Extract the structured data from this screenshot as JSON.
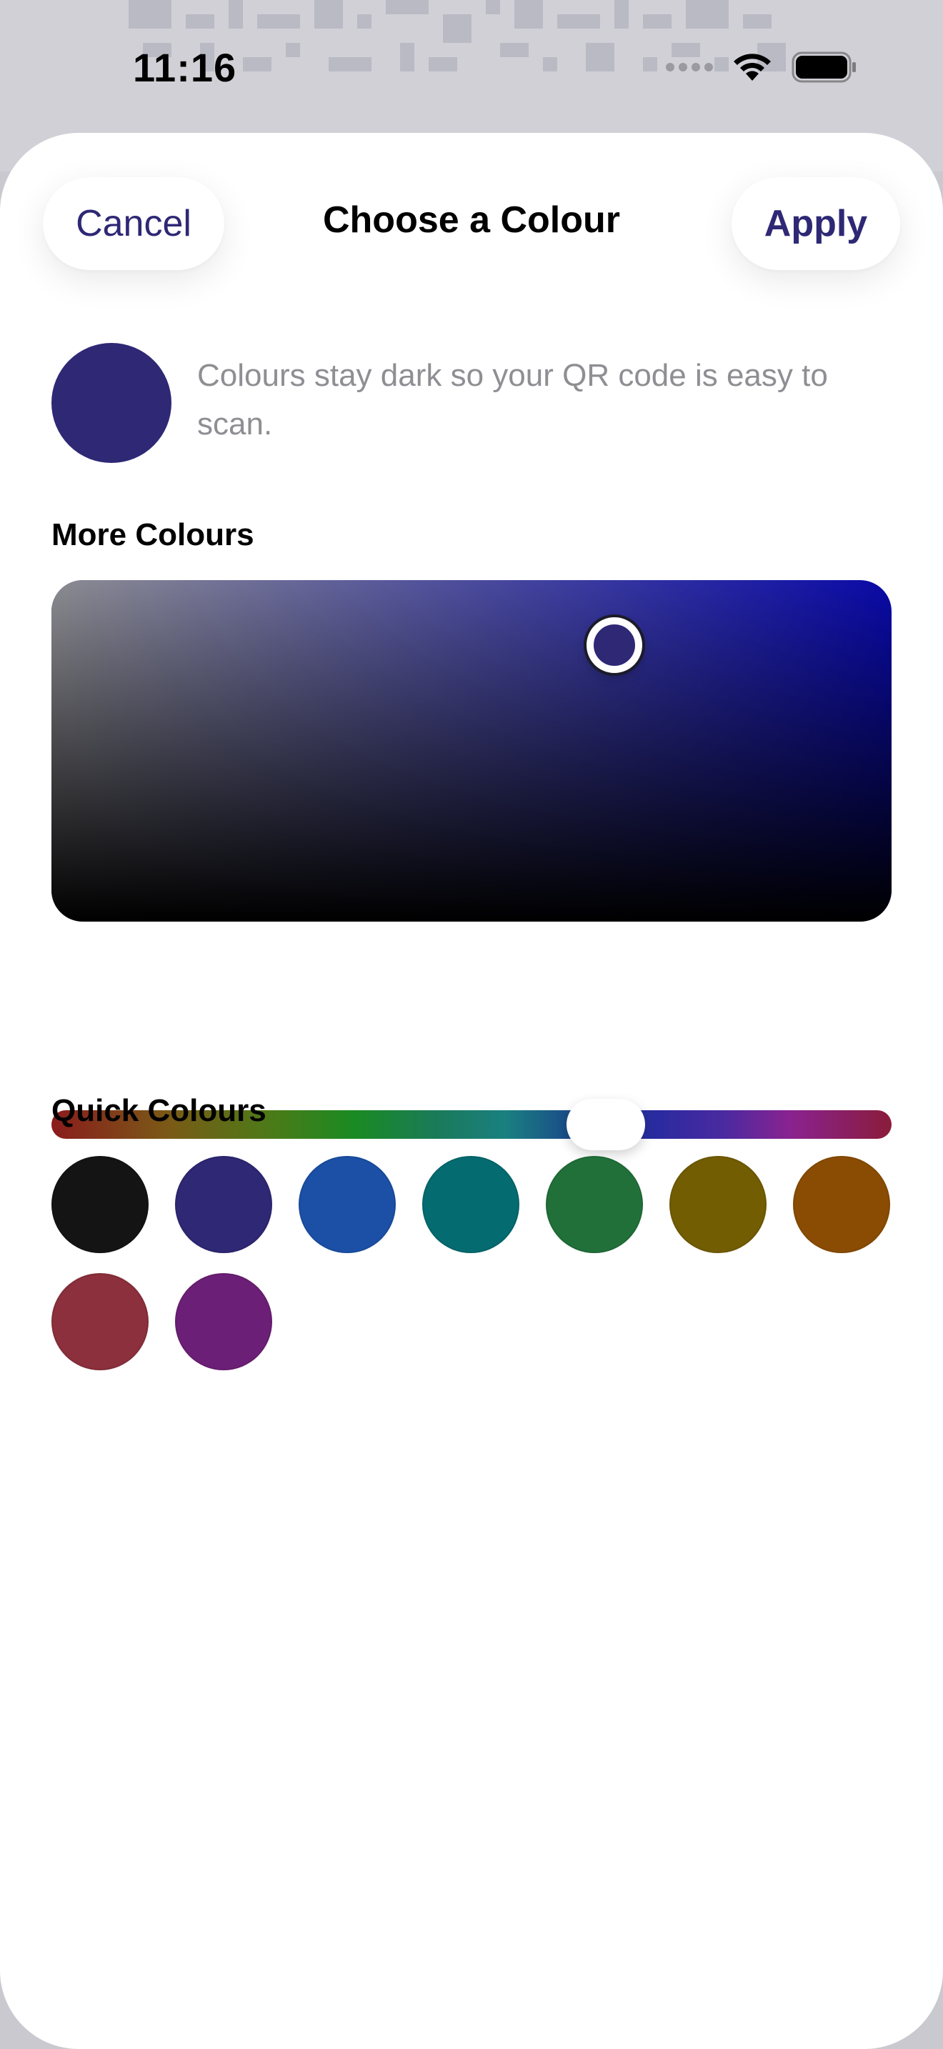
{
  "status_bar": {
    "time": "11:16"
  },
  "header": {
    "cancel_label": "Cancel",
    "title": "Choose a Colour",
    "apply_label": "Apply"
  },
  "preview": {
    "color": "#2e2875",
    "note": "Colours stay dark so your QR code is easy to scan."
  },
  "more_colours": {
    "label": "More Colours",
    "hue_color": "#0a0aa8",
    "selected_saturation": 0.67,
    "selected_brightness": 0.81,
    "hue_position": 0.66
  },
  "quick_colours": {
    "label": "Quick Colours",
    "swatches": [
      {
        "name": "black",
        "color": "#141414"
      },
      {
        "name": "indigo",
        "color": "#2e2875"
      },
      {
        "name": "blue",
        "color": "#1b50a6"
      },
      {
        "name": "teal",
        "color": "#046b70"
      },
      {
        "name": "green",
        "color": "#21703a"
      },
      {
        "name": "olive",
        "color": "#725d02"
      },
      {
        "name": "orange",
        "color": "#8a4c02"
      },
      {
        "name": "red",
        "color": "#8b303c"
      },
      {
        "name": "purple",
        "color": "#6c1f76"
      }
    ]
  },
  "icons": {
    "wifi": "wifi-icon",
    "battery": "battery-icon",
    "cellular": "cellular-dots-icon"
  }
}
